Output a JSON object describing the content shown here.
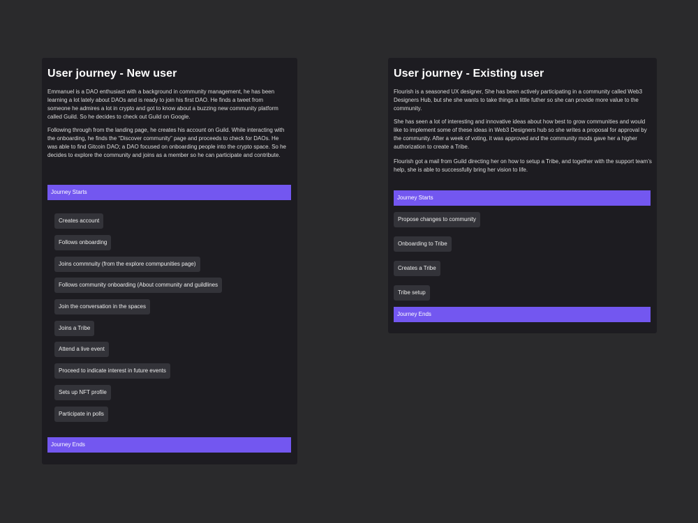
{
  "new_user": {
    "title": "User journey - New user",
    "paragraphs": [
      "Emmanuel is a DAO enthusiast with a background in community management, he has been learning a lot lately about DAOs and is ready to join his first DAO. He finds a tweet from someone he admires a lot in crypto and got to know about a buzzing new community platform called Guild. So he decides to check out Guild on Google.",
      "Following through from the landing page, he creates his account on Guild. While interacting with the onboarding, he finds the “Discover community” page and proceeds to check for DAOs. He was able to find Gitcoin DAO; a DAO focused on onboarding people into the crypto space. So he decides to explore the community and joins as a member so he can participate and contribute."
    ],
    "start_label": "Journey Starts",
    "end_label": "Journey Ends",
    "steps": [
      "Creates account",
      "Follows onboarding",
      "Joins commnuity (from the explore commpunities page)",
      "Follows community onboarding (About community and guildlines",
      "Join the conversation in the spaces",
      "Joins a Tribe",
      "Attend a live event",
      "Proceed to indicate interest in future events",
      "Sets up NFT profile",
      "Participate in polls"
    ]
  },
  "existing_user": {
    "title": "User journey - Existing user",
    "paragraphs": [
      "Flourish is a seasoned UX designer, She has been actively participating in a community called Web3 Designers Hub, but she she wants to take things a little futher so she can provide more value to the community.",
      "She has seen a lot of interesting and innovative ideas about how best to grow communities and would like to implement some of these ideas in Web3 Designers hub so she writes a proposal for approval by the community. After a week of voting, it was approved and the community mods gave her a higher authorization to create a Tribe.",
      "Flourish got a mail from Guild directing her on how to setup a Tribe, and together with the support team’s help, she is able to successfully bring her vision to life."
    ],
    "start_label": "Journey Starts",
    "end_label": "Journey Ends",
    "steps": [
      "Propose changes to community",
      "Onboarding to Tribe",
      "Creates a Tribe",
      "Tribe setup"
    ]
  },
  "colors": {
    "background": "#2a2a2c",
    "card": "#1d1c21",
    "accent_bar": "#7357f0",
    "step_chip": "#333339"
  }
}
